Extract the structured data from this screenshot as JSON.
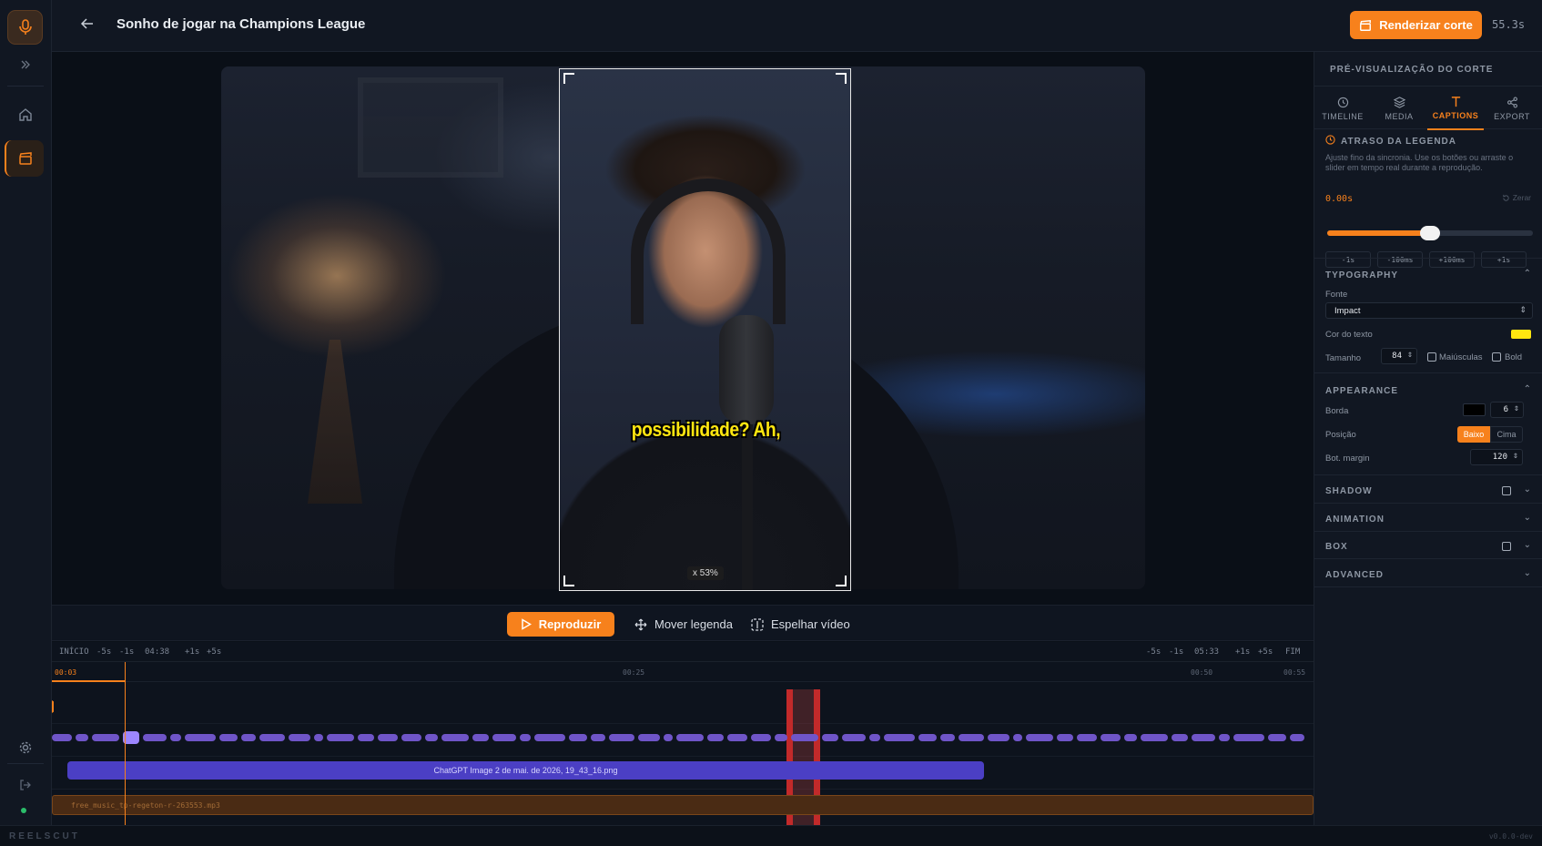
{
  "app": {
    "brand": "REELSCUT",
    "version": "v0.0.0-dev"
  },
  "header": {
    "title": "Sonho de jogar na Champions League",
    "render_label": "Renderizar corte",
    "duration": "55.3s"
  },
  "preview": {
    "caption_text": "possibilidade? Ah,",
    "zoom_chip": "x 53%"
  },
  "controls": {
    "play_label": "Reproduzir",
    "move_caption_label": "Mover legenda",
    "mirror_label": "Espelhar vídeo"
  },
  "timeline": {
    "ruler_left": [
      "INÍCIO",
      "-5s",
      "-1s",
      "04:38",
      "+1s",
      "+5s"
    ],
    "ruler_right": [
      "-5s",
      "-1s",
      "05:33",
      "+1s",
      "+5s",
      "FIM"
    ],
    "time_marks": [
      "00:03",
      "00:25",
      "00:50",
      "00:55"
    ],
    "image_clip": "ChatGPT Image 2 de mai. de 2026, 19_43_16.png",
    "audio_clip": "free_music_tp-regeton-r-263553.mp3"
  },
  "panel": {
    "heading": "PRÉ-VISUALIZAÇÃO DO CORTE",
    "tabs": [
      {
        "label": "TIMELINE",
        "icon": "clock-icon"
      },
      {
        "label": "MEDIA",
        "icon": "layers-icon"
      },
      {
        "label": "CAPTIONS",
        "icon": "text-icon"
      },
      {
        "label": "EXPORT",
        "icon": "share-icon"
      }
    ],
    "active_tab": "CAPTIONS",
    "delay": {
      "title": "ATRASO DA LEGENDA",
      "help": "Ajuste fino da sincronia. Use os botões ou arraste o slider em tempo real durante a reprodução.",
      "value": "0.00s",
      "reset_label": "Zerar",
      "slider_fraction": 0.5,
      "steps": [
        "-1s",
        "-100ms",
        "+100ms",
        "+1s"
      ]
    },
    "typography": {
      "title": "TYPOGRAPHY",
      "font_label": "Fonte",
      "font_value": "Impact",
      "color_label": "Cor do texto",
      "color_value": "#ffe610",
      "size_label": "Tamanho",
      "size_value": "84",
      "uppercase_label": "Maiúsculas",
      "bold_label": "Bold"
    },
    "appearance": {
      "title": "APPEARANCE",
      "border_label": "Borda",
      "border_color": "#000000",
      "border_value": "6",
      "position_label": "Posição",
      "position_options": [
        "Baixo",
        "Cima"
      ],
      "position_selected": "Baixo",
      "margin_label": "Bot. margin",
      "margin_value": "120"
    },
    "sections": [
      "SHADOW",
      "ANIMATION",
      "BOX",
      "ADVANCED"
    ]
  },
  "colors": {
    "accent": "#f7811c",
    "caption": "#ffe610",
    "clip_image": "#4b3fc4",
    "marker": "#c22a2a"
  }
}
